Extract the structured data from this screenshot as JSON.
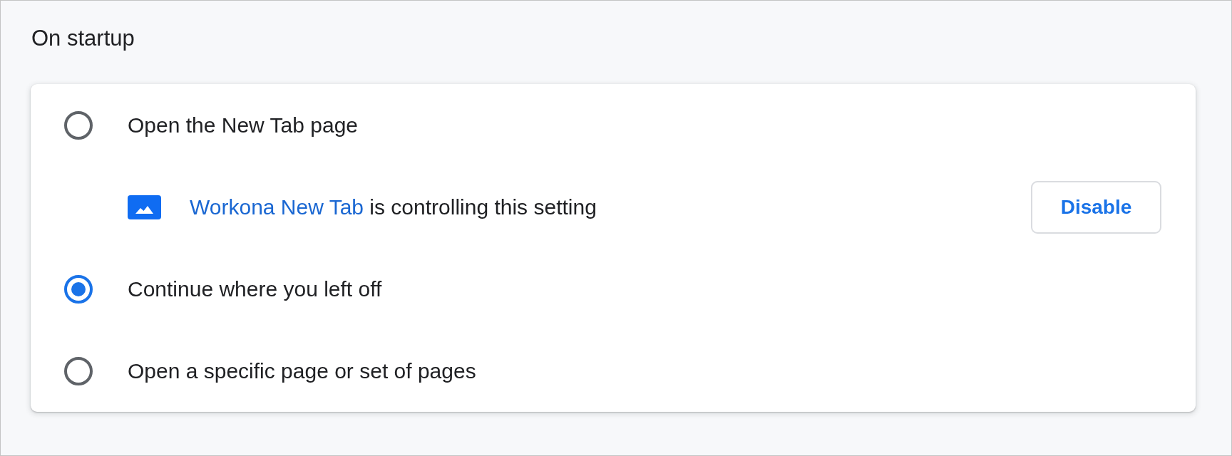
{
  "section": {
    "title": "On startup"
  },
  "options": [
    {
      "kind": "radio",
      "label": "Open the New Tab page",
      "selected": false
    },
    {
      "kind": "notice",
      "link": "Workona New Tab",
      "text": "is controlling this setting",
      "button": "Disable"
    },
    {
      "kind": "radio",
      "label": "Continue where you left off",
      "selected": true
    },
    {
      "kind": "radio",
      "label": "Open a specific page or set of pages",
      "selected": false
    }
  ]
}
